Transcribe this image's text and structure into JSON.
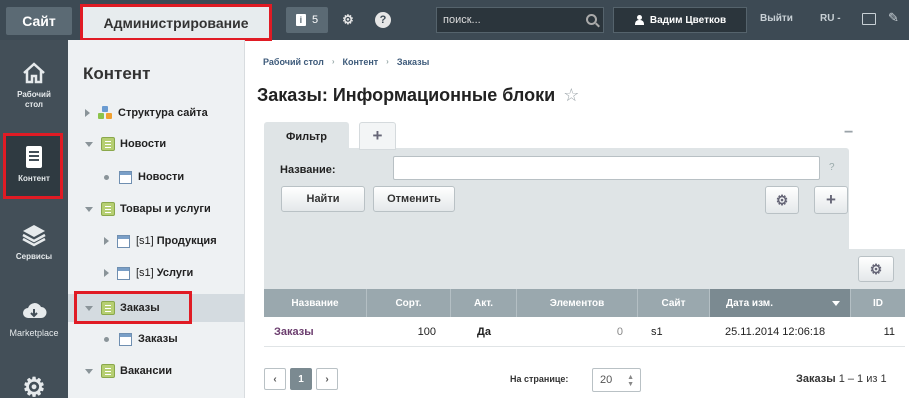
{
  "topbar": {
    "site_label": "Сайт",
    "admin_label": "Администрирование",
    "notifications_count": "5",
    "search_placeholder": "поиск...",
    "user_name": "Вадим Цветков",
    "logout_label": "Выйти",
    "language": "RU -"
  },
  "left_nav": {
    "items": [
      {
        "label": "Рабочий стол",
        "icon": "home-icon"
      },
      {
        "label": "Контент",
        "icon": "document-icon"
      },
      {
        "label": "Сервисы",
        "icon": "layers-icon"
      },
      {
        "label": "Marketplace",
        "icon": "cloud-icon"
      },
      {
        "label": "",
        "icon": "gear-icon"
      }
    ]
  },
  "tree": {
    "title": "Контент",
    "items": [
      {
        "label": "Структура сайта"
      },
      {
        "label": "Новости"
      },
      {
        "label": "Новости"
      },
      {
        "label": "Товары и услуги"
      },
      {
        "label": "[s1]",
        "label2": "Продукция"
      },
      {
        "label": "[s1]",
        "label2": "Услуги"
      },
      {
        "label": "Заказы"
      },
      {
        "label": "Заказы"
      },
      {
        "label": "Вакансии"
      }
    ]
  },
  "breadcrumb": [
    "Рабочий стол",
    "Контент",
    "Заказы"
  ],
  "page_title": "Заказы: Информационные блоки",
  "filter": {
    "tab_label": "Фильтр",
    "add_tab": "+",
    "collapse": "−",
    "name_label": "Название:",
    "name_value": "",
    "help": "?",
    "find_label": "Найти",
    "cancel_label": "Отменить",
    "add_label": "+"
  },
  "table": {
    "columns": [
      "Название",
      "Сорт.",
      "Акт.",
      "Элементов",
      "Сайт",
      "Дата изм.",
      "ID"
    ],
    "rows": [
      {
        "name": "Заказы",
        "sort": "100",
        "active": "Да",
        "elements": "0",
        "site": "s1",
        "date": "25.11.2014 12:06:18",
        "id": "11"
      }
    ]
  },
  "pager": {
    "current": "1",
    "per_page_label": "На странице:",
    "per_page": "20",
    "total_label": "Заказы",
    "total_value": "1 – 1 из 1"
  }
}
